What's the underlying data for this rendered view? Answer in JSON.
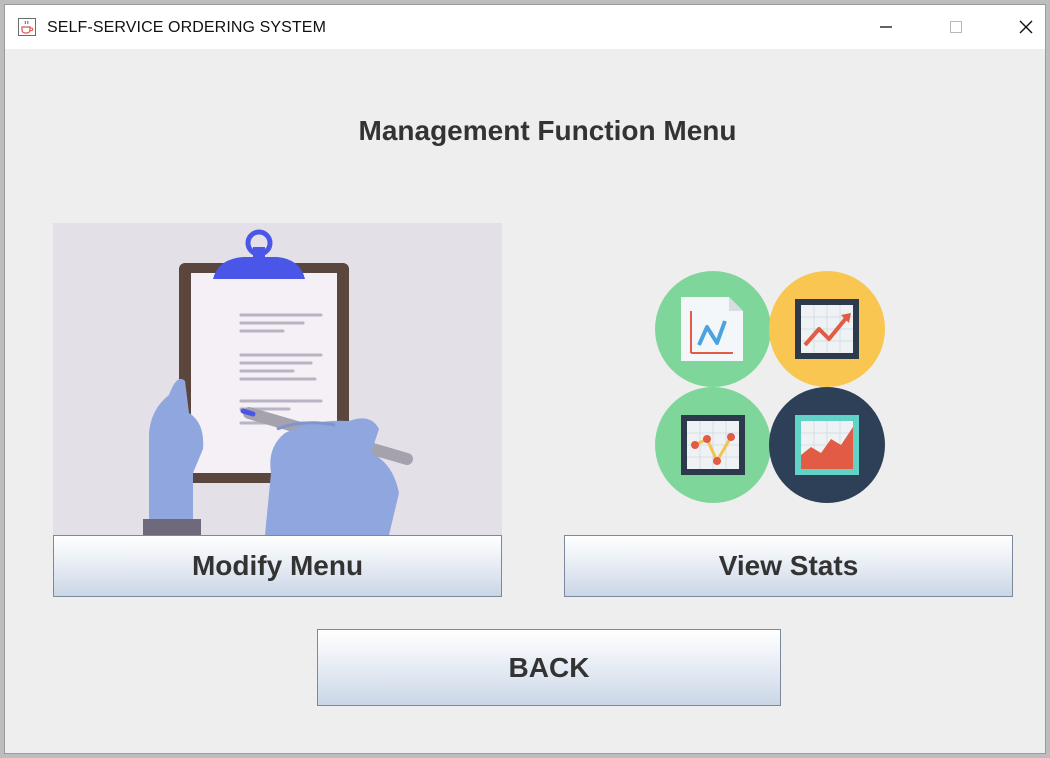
{
  "window": {
    "title": "SELF-SERVICE ORDERING SYSTEM",
    "app_icon": "java-cup-icon",
    "controls": {
      "minimize_icon": "minimize-icon",
      "maximize_icon": "maximize-icon",
      "close_icon": "close-icon"
    }
  },
  "main": {
    "heading": "Management Function Menu",
    "modify_menu_label": "Modify Menu",
    "view_stats_label": "View Stats",
    "back_label": "BACK"
  },
  "images": {
    "modify_menu_illustration": "clipboard-writing-illustration",
    "view_stats_illustration": "statistics-charts-icons"
  },
  "colors": {
    "window_background": "#eeeeee",
    "button_gradient_top": "#ffffff",
    "button_gradient_bottom": "#c9d6e6",
    "button_border": "#7a8a9c",
    "text": "#333333",
    "illustration_background": "#e4e0e8",
    "clipboard_clip": "#4a56e8",
    "hand": "#8fa7de",
    "circle_green": "#7fd69a",
    "circle_yellow": "#f9c651",
    "circle_navy": "#2d4057"
  }
}
